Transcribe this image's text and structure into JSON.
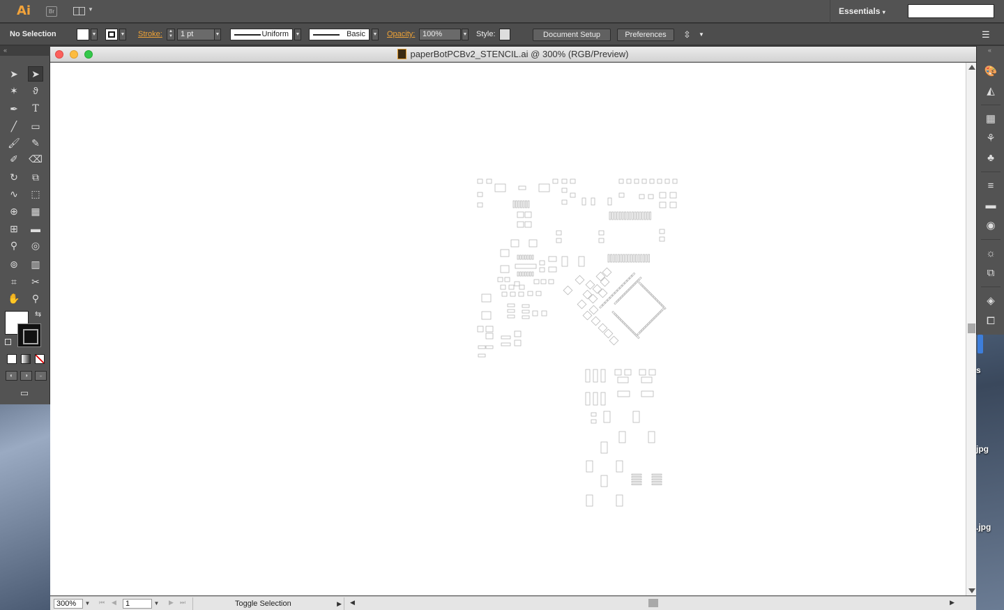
{
  "app": {
    "logo": "Ai",
    "bridge_label": "Br",
    "workspace": "Essentials",
    "search_placeholder": ""
  },
  "control": {
    "selection": "No Selection",
    "stroke_label": "Stroke:",
    "stroke_weight": "1 pt",
    "profile": "Uniform",
    "brush": "Basic",
    "opacity_label": "Opacity:",
    "opacity": "100%",
    "style_label": "Style:",
    "document_setup": "Document Setup",
    "preferences": "Preferences"
  },
  "document": {
    "title": "paperBotPCBv2_STENCIL.ai @ 300% (RGB/Preview)",
    "zoom": "300%",
    "artboard": "1",
    "status": "Toggle Selection"
  },
  "desktop": {
    "file_label_1": "s",
    "file_label_2": "jpg",
    "file_label_3": ".jpg"
  },
  "tools": [
    "selection-tool",
    "direct-selection-tool",
    "magic-wand-tool",
    "lasso-tool",
    "pen-tool",
    "type-tool",
    "line-tool",
    "rectangle-tool",
    "paintbrush-tool",
    "pencil-tool",
    "blob-brush-tool",
    "eraser-tool",
    "rotate-tool",
    "scale-tool",
    "warp-tool",
    "free-transform-tool",
    "shape-builder-tool",
    "perspective-grid-tool",
    "mesh-tool",
    "gradient-tool",
    "eyedropper-tool",
    "blend-tool",
    "symbol-sprayer-tool",
    "column-graph-tool",
    "artboard-tool",
    "slice-tool",
    "hand-tool",
    "zoom-tool"
  ],
  "colors": {
    "fill": "#ffffff",
    "stroke": "#111111",
    "accent": "#f0a336",
    "pad_stroke": "#b8b8b8"
  }
}
